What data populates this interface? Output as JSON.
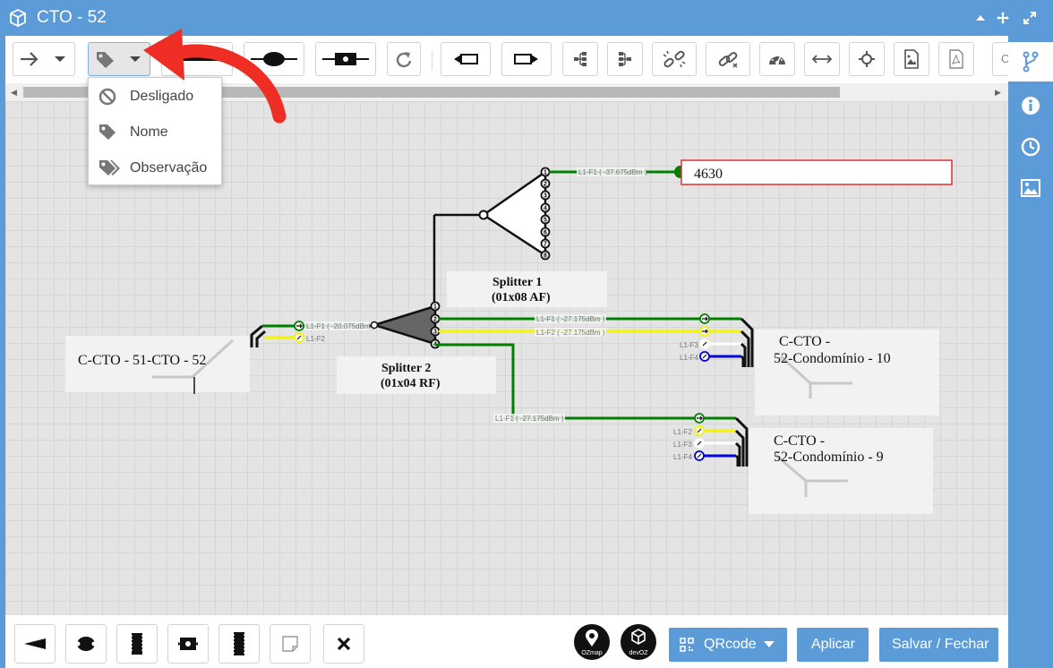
{
  "window": {
    "title": "CTO - 52",
    "icon": "box-icon"
  },
  "title_controls": [
    "caret-up-icon",
    "move-icon",
    "expand-icon"
  ],
  "toolbar": {
    "buttons": [
      "arrow-right-dropdown-icon",
      "tag-dropdown-icon",
      "cable-icon",
      "fusion-icon",
      "connector-icon",
      "redo-icon",
      "splitter-left-icon",
      "splitter-right-icon",
      "tree-left-icon",
      "tree-right-icon",
      "unlink-icon",
      "link-icon",
      "gauge-icon",
      "resize-horizontal-icon",
      "center-icon",
      "image-file-icon",
      "pdf-file-icon"
    ],
    "search_placeholder": "C"
  },
  "label_menu": {
    "items": [
      {
        "icon": "ban-icon",
        "label": "Desligado"
      },
      {
        "icon": "tag-icon",
        "label": "Nome"
      },
      {
        "icon": "tags-icon",
        "label": "Observação"
      }
    ]
  },
  "diagram": {
    "splitter1": {
      "line1": "Splitter 1",
      "line2": "(01x08 AF)",
      "ports": [
        "1",
        "2",
        "3",
        "4",
        "5",
        "6",
        "7",
        "8"
      ]
    },
    "splitter2": {
      "line1": "Splitter 2",
      "line2": "(01x04 RF)",
      "ports": [
        "1",
        "2",
        "3",
        "4"
      ]
    },
    "client": {
      "name": "4630",
      "fiber_label": "L1-F1 ( -37.675dBm )"
    },
    "cable_in": {
      "name": "C-CTO - 51-CTO - 52",
      "fibers": [
        "L1-F1 ( -20.075dBm )",
        "L1-F2"
      ]
    },
    "cable_out_10": {
      "name_line1": "C-CTO -",
      "name_line2": "52-Condomínio - 10",
      "fibers": [
        "L1-F1 ( -27.175dBm )",
        "L1-F2 ( -27.175dBm )",
        "L1-F3",
        "L1-F4"
      ]
    },
    "cable_out_9": {
      "name_line1": "C-CTO -",
      "name_line2": "52-Condomínio - 9",
      "fibers": [
        "L1-F1 ( -27.175dBm )",
        "L1-F2",
        "L1-F3",
        "L1-F4"
      ]
    },
    "colors": {
      "green": "#008000",
      "yellow": "#f5f500",
      "white": "#ffffff",
      "blue": "#0000dd",
      "client_border": "#e03030"
    }
  },
  "sidebar": {
    "items": [
      "fork-icon",
      "info-icon",
      "clock-icon",
      "image-icon"
    ]
  },
  "bottom": {
    "tools": [
      "splitter-shape-icon",
      "fusion-shape-icon",
      "dio-icon",
      "connector-shape-icon",
      "terminal-icon",
      "note-icon",
      "close-icon"
    ],
    "logo1": "OZmap",
    "logo2": "devOZ",
    "qrcode_label": "QRcode",
    "apply_label": "Aplicar",
    "save_label": "Salvar / Fechar"
  }
}
